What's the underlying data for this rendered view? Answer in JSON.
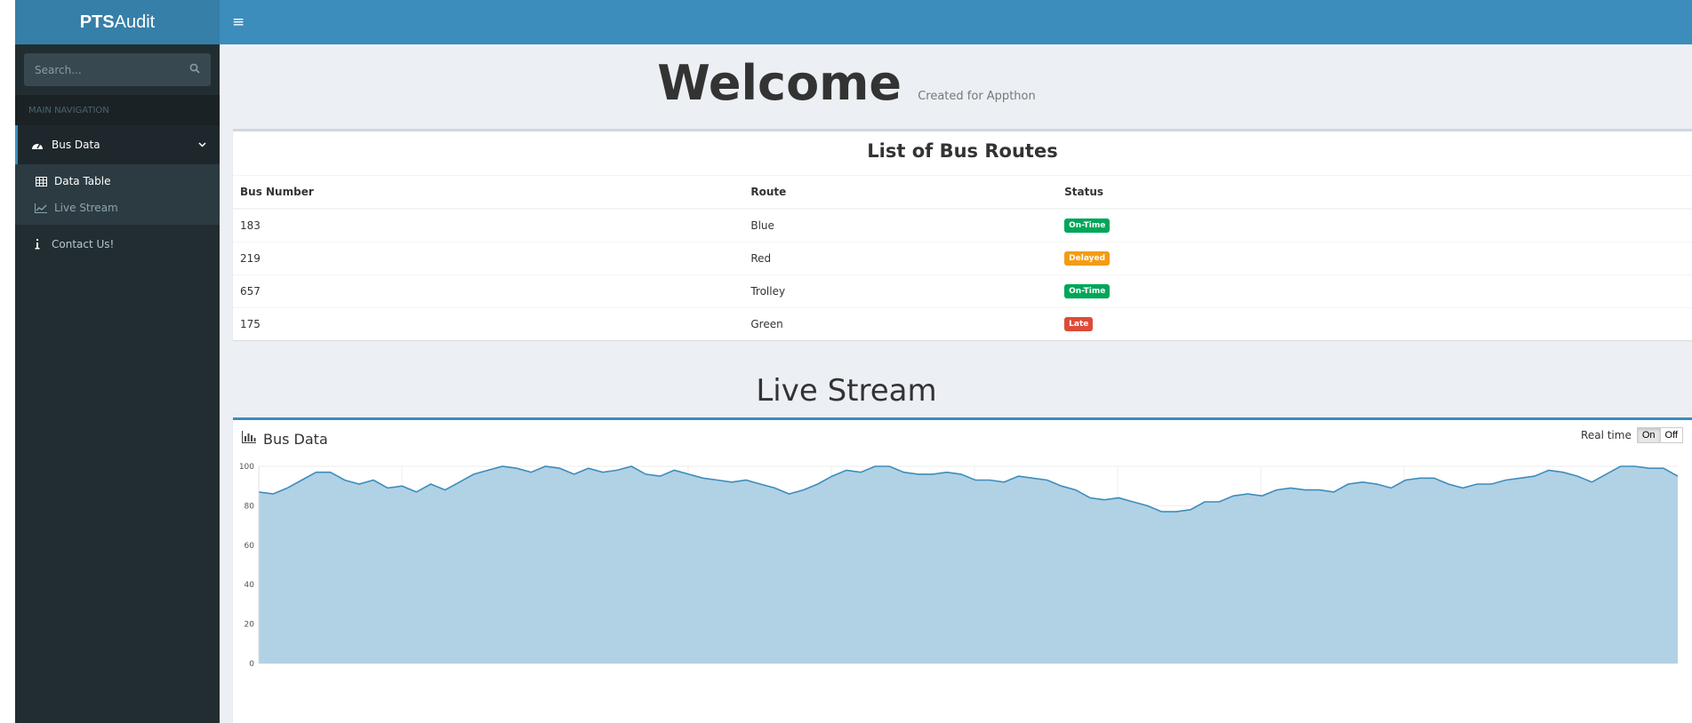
{
  "brand": {
    "bold": "PTS",
    "light": "Audit"
  },
  "search": {
    "placeholder": "Search..."
  },
  "sidebar": {
    "header": "MAIN NAVIGATION",
    "bus_data": "Bus Data",
    "sub_items": [
      {
        "label": "Data Table"
      },
      {
        "label": "Live Stream"
      }
    ],
    "contact": "Contact Us!"
  },
  "welcome": {
    "title": "Welcome",
    "subtitle": "Created for Appthon"
  },
  "routes_table": {
    "title": "List of Bus Routes",
    "headers": [
      "Bus Number",
      "Route",
      "Status"
    ],
    "rows": [
      {
        "bus": "183",
        "route": "Blue",
        "status": "On-Time",
        "color": "#00a65a"
      },
      {
        "bus": "219",
        "route": "Red",
        "status": "Delayed",
        "color": "#f39c12"
      },
      {
        "bus": "657",
        "route": "Trolley",
        "status": "On-Time",
        "color": "#00a65a"
      },
      {
        "bus": "175",
        "route": "Green",
        "status": "Late",
        "color": "#dd4b39"
      }
    ]
  },
  "live_stream": {
    "title": "Live Stream"
  },
  "chart_box": {
    "title": "Bus Data",
    "realtime_label": "Real time",
    "on": "On",
    "off": "Off"
  },
  "colors": {
    "accent": "#3c8dbc",
    "fill": "#b1d1e5",
    "sidebar": "#222d32"
  },
  "chart_data": {
    "type": "area",
    "ylim": [
      0,
      100
    ],
    "yticks": [
      0,
      20,
      40,
      60,
      80,
      100
    ],
    "values": [
      87,
      86,
      89,
      93,
      97,
      97,
      93,
      91,
      93,
      89,
      90,
      87,
      91,
      88,
      92,
      96,
      98,
      100,
      99,
      97,
      100,
      99,
      96,
      99,
      97,
      98,
      100,
      96,
      95,
      98,
      96,
      94,
      93,
      92,
      93,
      91,
      89,
      86,
      88,
      91,
      95,
      98,
      97,
      100,
      100,
      97,
      96,
      96,
      97,
      96,
      93,
      93,
      92,
      95,
      94,
      93,
      90,
      88,
      84,
      83,
      84,
      82,
      80,
      77,
      77,
      78,
      82,
      82,
      85,
      86,
      85,
      88,
      89,
      88,
      88,
      87,
      91,
      92,
      91,
      89,
      93,
      94,
      94,
      91,
      89,
      91,
      91,
      93,
      94,
      95,
      98,
      97,
      95,
      92,
      96,
      100,
      100,
      99,
      99,
      95
    ],
    "grid": true
  }
}
